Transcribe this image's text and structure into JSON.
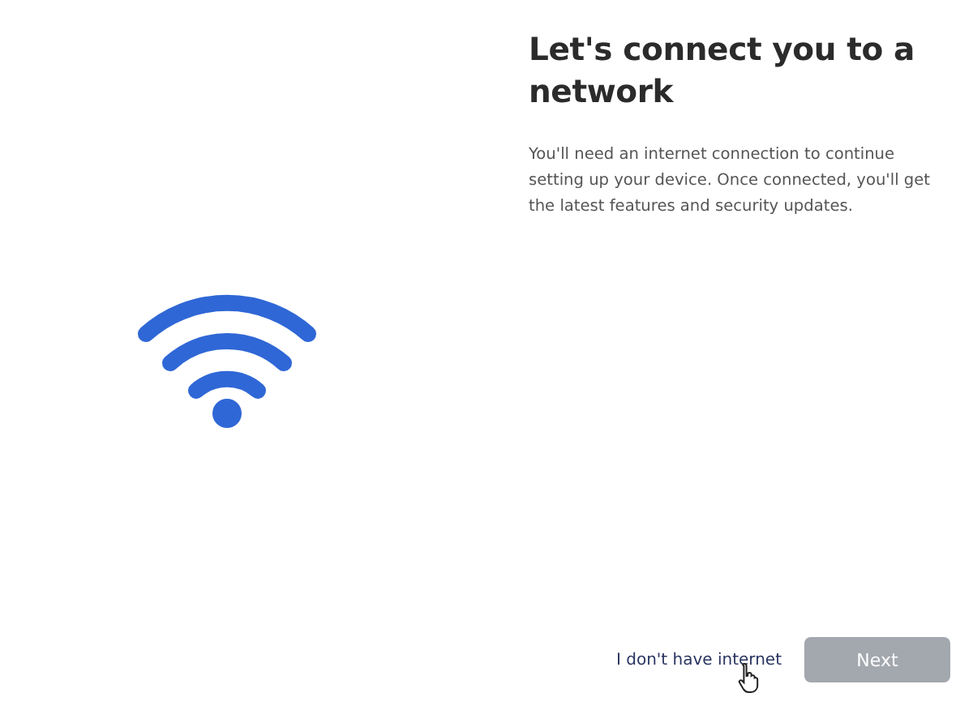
{
  "heading": "Let's connect you to a network",
  "description": "You'll need an internet connection to continue setting up your device. Once connected, you'll get the latest features and security updates.",
  "skip_link": "I don't have internet",
  "next_button": {
    "label": "Next",
    "disabled": true
  }
}
